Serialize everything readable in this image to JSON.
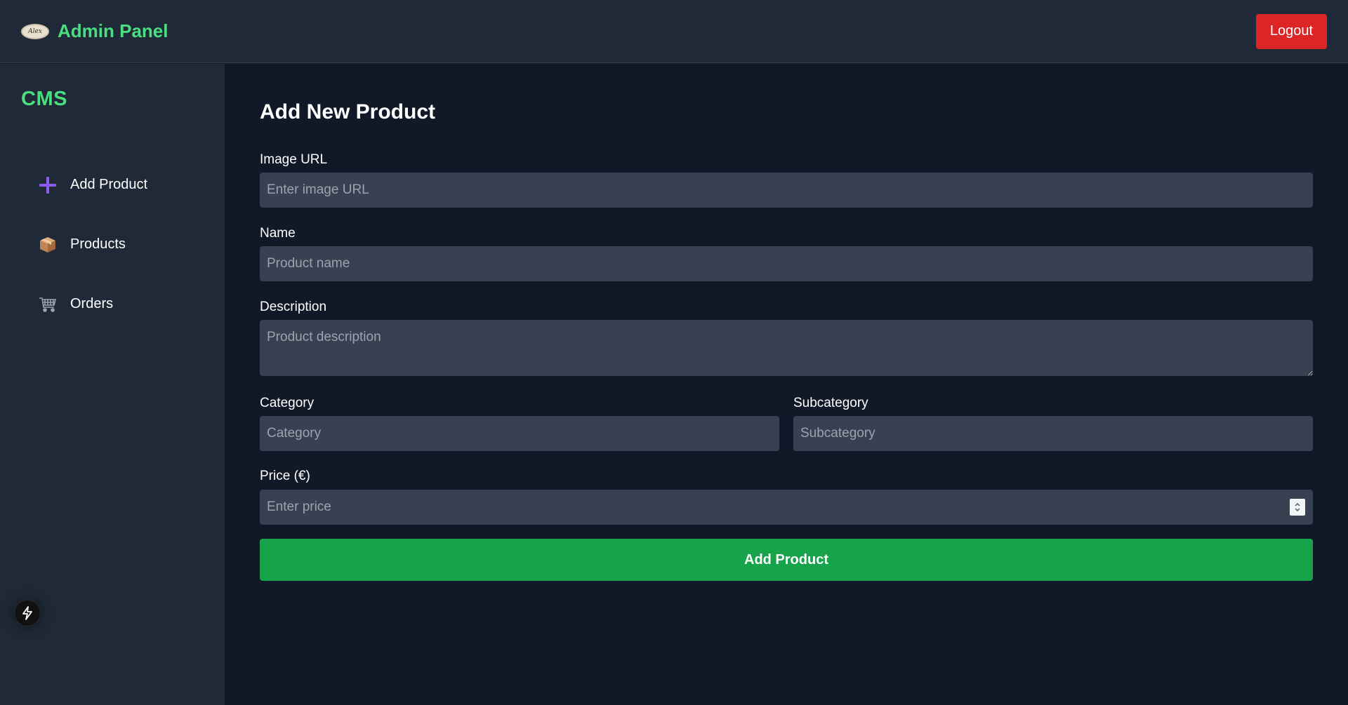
{
  "header": {
    "logo_text": "Alex",
    "title": "Admin Panel",
    "logout_label": "Logout"
  },
  "sidebar": {
    "title": "CMS",
    "items": [
      {
        "label": "Add Product",
        "icon": "plus-icon"
      },
      {
        "label": "Products",
        "icon": "package-icon"
      },
      {
        "label": "Orders",
        "icon": "shopping-cart-icon"
      }
    ],
    "bolt_icon": "lightning-bolt-icon"
  },
  "form": {
    "title": "Add New Product",
    "image_url": {
      "label": "Image URL",
      "placeholder": "Enter image URL",
      "value": ""
    },
    "name": {
      "label": "Name",
      "placeholder": "Product name",
      "value": ""
    },
    "description": {
      "label": "Description",
      "placeholder": "Product description",
      "value": ""
    },
    "category": {
      "label": "Category",
      "placeholder": "Category",
      "value": ""
    },
    "subcategory": {
      "label": "Subcategory",
      "placeholder": "Subcategory",
      "value": ""
    },
    "price": {
      "label": "Price (€)",
      "placeholder": "Enter price",
      "value": ""
    },
    "submit_label": "Add Product"
  },
  "colors": {
    "accent_green": "#4ade80",
    "button_green": "#16a34a",
    "logout_red": "#dc2626",
    "sidebar_bg": "#1f2937",
    "main_bg": "#111827",
    "input_bg": "#374151"
  }
}
